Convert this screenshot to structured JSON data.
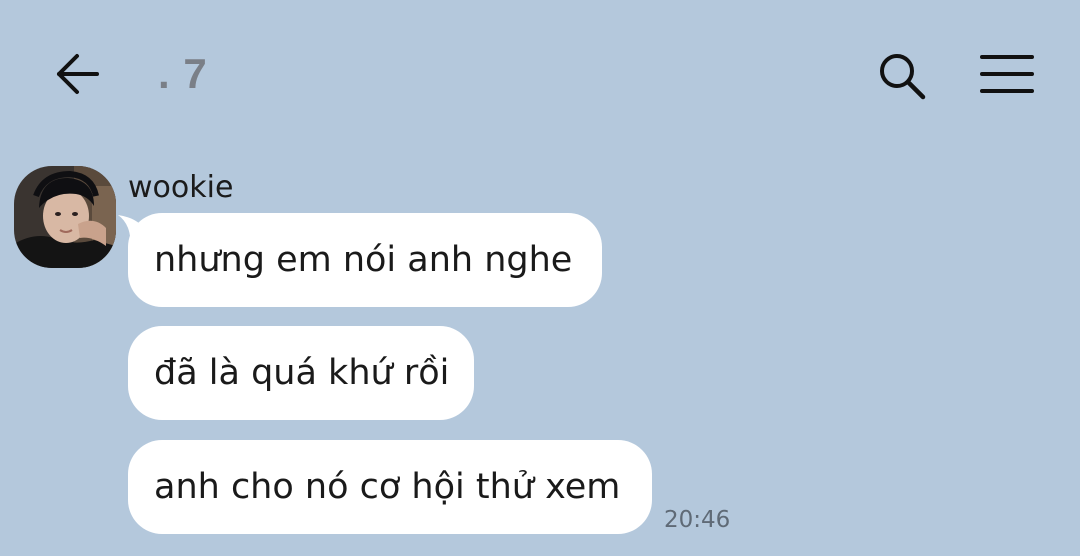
{
  "header": {
    "title": ". 7",
    "back_icon": "arrow-left-icon",
    "search_icon": "search-icon",
    "menu_icon": "hamburger-menu-icon"
  },
  "conversation": {
    "sender": {
      "name": "wookie",
      "avatar": "profile-photo"
    },
    "messages": [
      {
        "text": "nhưng em nói anh nghe"
      },
      {
        "text": "đã là quá khứ rồi"
      },
      {
        "text": "anh cho nó cơ hội thử xem"
      }
    ],
    "timestamp": "20:46"
  },
  "colors": {
    "background": "#b4c8dc",
    "bubble": "#ffffff",
    "title": "#7a7f87",
    "timestamp": "#5f6a76"
  }
}
